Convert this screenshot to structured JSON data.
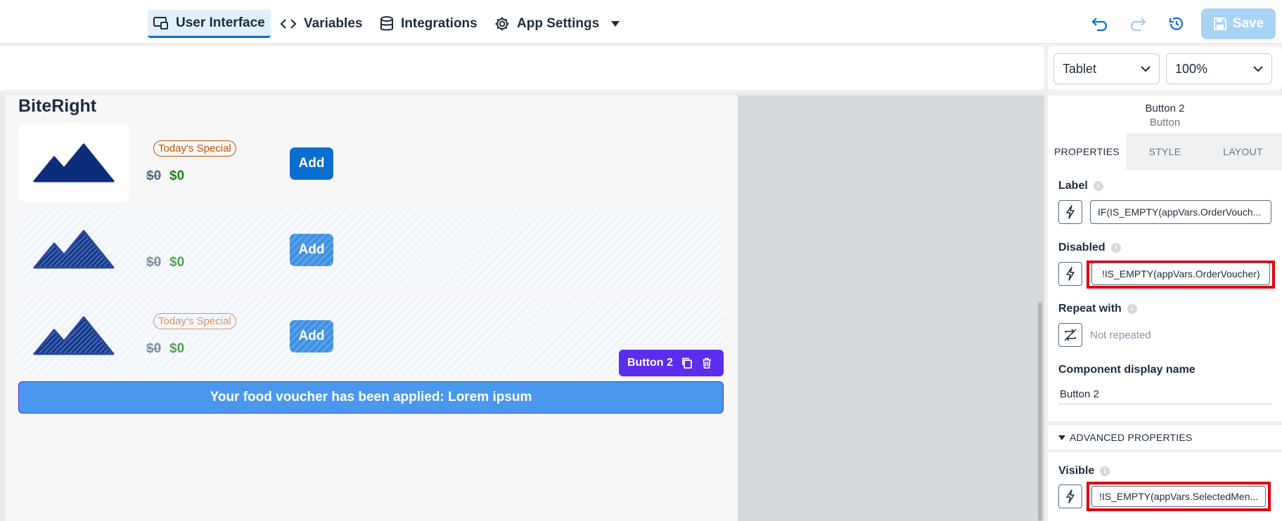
{
  "nav": {
    "tabs": [
      {
        "label": "User Interface",
        "icon": "ui-design-icon"
      },
      {
        "label": "Variables",
        "icon": "code-icon"
      },
      {
        "label": "Integrations",
        "icon": "database-icon"
      },
      {
        "label": "App Settings",
        "icon": "gear-icon"
      }
    ],
    "save_label": "Save"
  },
  "view": {
    "device": "Tablet",
    "zoom": "100%"
  },
  "canvas": {
    "brand": "BiteRight",
    "items": [
      {
        "badge": "Today's Special",
        "old_price": "$0",
        "new_price": "$0",
        "add_label": "Add"
      },
      {
        "badge": "",
        "old_price": "$0",
        "new_price": "$0",
        "add_label": "Add"
      },
      {
        "badge": "Today's Special",
        "old_price": "$0",
        "new_price": "$0",
        "add_label": "Add"
      }
    ],
    "selected_tag": "Button 2",
    "voucher_text": "Your food voucher has been applied: Lorem ipsum"
  },
  "panel": {
    "component_name": "Button 2",
    "component_type": "Button",
    "tabs": [
      "PROPERTIES",
      "STYLE",
      "LAYOUT"
    ],
    "label_title": "Label",
    "label_value": "IF(IS_EMPTY(appVars.OrderVouch...",
    "disabled_title": "Disabled",
    "disabled_value": "!IS_EMPTY(appVars.OrderVoucher)",
    "repeat_title": "Repeat with",
    "repeat_value": "Not repeated",
    "display_name_title": "Component display name",
    "display_name_value": "Button 2",
    "advanced_title": "ADVANCED PROPERTIES",
    "visible_title": "Visible",
    "visible_value": "!IS_EMPTY(appVars.SelectedMen..."
  },
  "colors": {
    "accent": "#0a6ed1",
    "selection": "#5b2ded",
    "highlight": "#e1000f"
  }
}
